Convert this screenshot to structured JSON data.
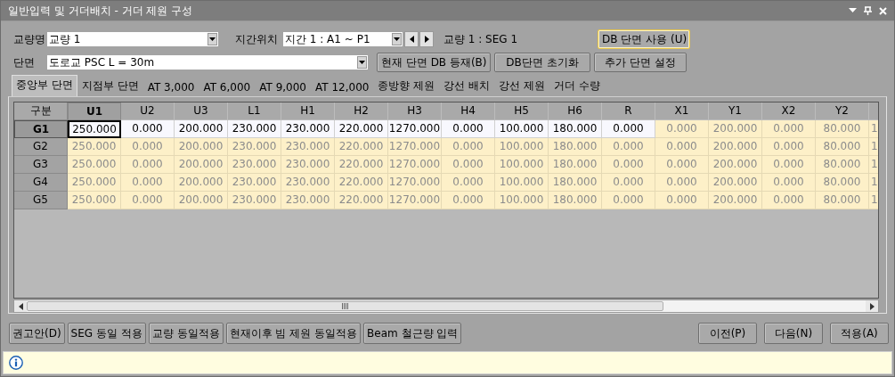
{
  "window": {
    "title": "일반입력 및 거더배치 - 거더 제원 구성"
  },
  "form": {
    "bridge_label": "교량명",
    "bridge_value": "교량 1",
    "span_label": "지간위치",
    "span_value": "지간 1 : A1 ~ P1",
    "segment_text": "교량 1 : SEG 1",
    "section_label": "단면",
    "section_value": "도로교 PSC L = 30m"
  },
  "top_buttons": {
    "row_1": [
      {
        "label": "DB 단면 사용 (U)",
        "focused": true
      }
    ],
    "row_2": [
      {
        "label": "현재 단면 DB 등재(B)",
        "focused": false
      },
      {
        "label": "DB단면 초기화",
        "focused": false
      },
      {
        "label": "추가 단면 설정",
        "focused": false
      }
    ]
  },
  "tabs": [
    {
      "label": "중앙부 단면",
      "selected": true
    },
    {
      "label": "지점부 단면",
      "selected": false
    },
    {
      "label": "AT 3,000",
      "selected": false
    },
    {
      "label": "AT 6,000",
      "selected": false
    },
    {
      "label": "AT 9,000",
      "selected": false
    },
    {
      "label": "AT 12,000",
      "selected": false
    },
    {
      "label": "종방향 제원",
      "selected": false
    },
    {
      "label": "강선 배치",
      "selected": false
    },
    {
      "label": "강선 제원",
      "selected": false
    },
    {
      "label": "거더 수량",
      "selected": false
    }
  ],
  "table": {
    "corner": "구분",
    "columns": [
      {
        "label": "U1",
        "selected": true
      },
      {
        "label": "U2",
        "selected": false
      },
      {
        "label": "U3",
        "selected": false
      },
      {
        "label": "L1",
        "selected": false
      },
      {
        "label": "H1",
        "selected": false
      },
      {
        "label": "H2",
        "selected": false
      },
      {
        "label": "H3",
        "selected": false
      },
      {
        "label": "H4",
        "selected": false
      },
      {
        "label": "H5",
        "selected": false
      },
      {
        "label": "H6",
        "selected": false
      },
      {
        "label": "R",
        "selected": false
      },
      {
        "label": "X1",
        "selected": false
      },
      {
        "label": "Y1",
        "selected": false
      },
      {
        "label": "X2",
        "selected": false
      },
      {
        "label": "Y2",
        "selected": false
      }
    ],
    "rows": [
      {
        "label": "G1",
        "selected": true,
        "cells": [
          {
            "text": "250.000",
            "editable": true
          },
          {
            "text": "0.000",
            "editable": true
          },
          {
            "text": "200.000",
            "editable": true
          },
          {
            "text": "230.000",
            "editable": true
          },
          {
            "text": "230.000",
            "editable": true
          },
          {
            "text": "220.000",
            "editable": true
          },
          {
            "text": "1270.000",
            "editable": true
          },
          {
            "text": "0.000",
            "editable": true
          },
          {
            "text": "100.000",
            "editable": true
          },
          {
            "text": "180.000",
            "editable": true
          },
          {
            "text": "0.000",
            "editable": true
          },
          {
            "text": "0.000",
            "editable": false
          },
          {
            "text": "200.000",
            "editable": false
          },
          {
            "text": "0.000",
            "editable": false
          },
          {
            "text": "80.000",
            "editable": false
          },
          {
            "text": "1",
            "editable": false
          }
        ]
      },
      {
        "label": "G2",
        "selected": false,
        "cells": [
          {
            "text": "250.000",
            "editable": false
          },
          {
            "text": "0.000",
            "editable": false
          },
          {
            "text": "200.000",
            "editable": false
          },
          {
            "text": "230.000",
            "editable": false
          },
          {
            "text": "230.000",
            "editable": false
          },
          {
            "text": "220.000",
            "editable": false
          },
          {
            "text": "1270.000",
            "editable": false
          },
          {
            "text": "0.000",
            "editable": false
          },
          {
            "text": "100.000",
            "editable": false
          },
          {
            "text": "180.000",
            "editable": false
          },
          {
            "text": "0.000",
            "editable": false
          },
          {
            "text": "0.000",
            "editable": false
          },
          {
            "text": "200.000",
            "editable": false
          },
          {
            "text": "0.000",
            "editable": false
          },
          {
            "text": "80.000",
            "editable": false
          },
          {
            "text": "1",
            "editable": false
          }
        ]
      },
      {
        "label": "G3",
        "selected": false,
        "cells": [
          {
            "text": "250.000",
            "editable": false
          },
          {
            "text": "0.000",
            "editable": false
          },
          {
            "text": "200.000",
            "editable": false
          },
          {
            "text": "230.000",
            "editable": false
          },
          {
            "text": "230.000",
            "editable": false
          },
          {
            "text": "220.000",
            "editable": false
          },
          {
            "text": "1270.000",
            "editable": false
          },
          {
            "text": "0.000",
            "editable": false
          },
          {
            "text": "100.000",
            "editable": false
          },
          {
            "text": "180.000",
            "editable": false
          },
          {
            "text": "0.000",
            "editable": false
          },
          {
            "text": "0.000",
            "editable": false
          },
          {
            "text": "200.000",
            "editable": false
          },
          {
            "text": "0.000",
            "editable": false
          },
          {
            "text": "80.000",
            "editable": false
          },
          {
            "text": "1",
            "editable": false
          }
        ]
      },
      {
        "label": "G4",
        "selected": false,
        "cells": [
          {
            "text": "250.000",
            "editable": false
          },
          {
            "text": "0.000",
            "editable": false
          },
          {
            "text": "200.000",
            "editable": false
          },
          {
            "text": "230.000",
            "editable": false
          },
          {
            "text": "230.000",
            "editable": false
          },
          {
            "text": "220.000",
            "editable": false
          },
          {
            "text": "1270.000",
            "editable": false
          },
          {
            "text": "0.000",
            "editable": false
          },
          {
            "text": "100.000",
            "editable": false
          },
          {
            "text": "180.000",
            "editable": false
          },
          {
            "text": "0.000",
            "editable": false
          },
          {
            "text": "0.000",
            "editable": false
          },
          {
            "text": "200.000",
            "editable": false
          },
          {
            "text": "0.000",
            "editable": false
          },
          {
            "text": "80.000",
            "editable": false
          },
          {
            "text": "1",
            "editable": false
          }
        ]
      },
      {
        "label": "G5",
        "selected": false,
        "cells": [
          {
            "text": "250.000",
            "editable": false
          },
          {
            "text": "0.000",
            "editable": false
          },
          {
            "text": "200.000",
            "editable": false
          },
          {
            "text": "230.000",
            "editable": false
          },
          {
            "text": "230.000",
            "editable": false
          },
          {
            "text": "220.000",
            "editable": false
          },
          {
            "text": "1270.000",
            "editable": false
          },
          {
            "text": "0.000",
            "editable": false
          },
          {
            "text": "100.000",
            "editable": false
          },
          {
            "text": "180.000",
            "editable": false
          },
          {
            "text": "0.000",
            "editable": false
          },
          {
            "text": "0.000",
            "editable": false
          },
          {
            "text": "200.000",
            "editable": false
          },
          {
            "text": "0.000",
            "editable": false
          },
          {
            "text": "80.000",
            "editable": false
          },
          {
            "text": "1",
            "editable": false
          }
        ]
      }
    ]
  },
  "bottom_buttons": {
    "left": [
      {
        "label": "권고안(D)"
      },
      {
        "label": "SEG 동일 적용"
      },
      {
        "label": "교량 동일적용"
      },
      {
        "label": "현재이후 빔 제원 동일적용"
      },
      {
        "label": "Beam 철근량 입력"
      }
    ],
    "right": [
      {
        "label": "이전(P)"
      },
      {
        "label": "다음(N)"
      },
      {
        "label": "적용(A)"
      }
    ]
  },
  "status_bar": {
    "kind": "info"
  }
}
